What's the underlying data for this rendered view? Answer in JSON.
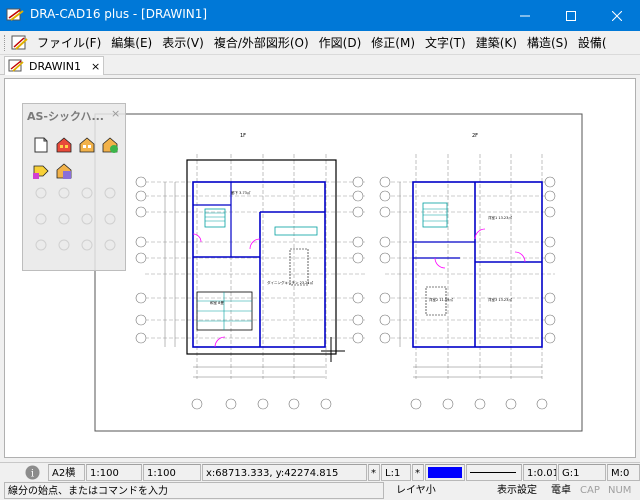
{
  "window": {
    "title": "DRA-CAD16 plus - [DRAWIN1]"
  },
  "menu": {
    "items": [
      "ファイル(F)",
      "編集(E)",
      "表示(V)",
      "複合/外部図形(O)",
      "作図(D)",
      "修正(M)",
      "文字(T)",
      "建築(K)",
      "構造(S)",
      "設備("
    ]
  },
  "tabs": [
    {
      "label": "DRAWIN1",
      "close": "×"
    }
  ],
  "palette": {
    "title": "AS-シックハ...",
    "close": "×"
  },
  "drawing": {
    "floor1_title": "1F",
    "floor2_title": "2F",
    "room_labels": [
      "廊下 3.73㎡",
      "ダイニングキッチン 23.21㎡",
      "和室 8畳",
      "洋室1 13.23㎡",
      "洋室2 11.59㎡",
      "洋室3 13.23㎡"
    ]
  },
  "status": {
    "info_icon": "info-icon",
    "paper": "A2横",
    "scale1": "1:100",
    "scale2": "1:100",
    "coords": "x:68713.333, y:42274.815",
    "layer_marker": "*",
    "layer": "L:1",
    "color_marker": "*",
    "color_swatch": "#0000ff",
    "ratio": "1:0.01",
    "group": "G:1",
    "mode": "M:0",
    "prompt": "線分の始点、またはコマンドを入力",
    "layer_small": "レイヤ小",
    "display_settings": "表示設定",
    "calculator": "電卓",
    "caps": "CAP",
    "num": "NUM"
  }
}
